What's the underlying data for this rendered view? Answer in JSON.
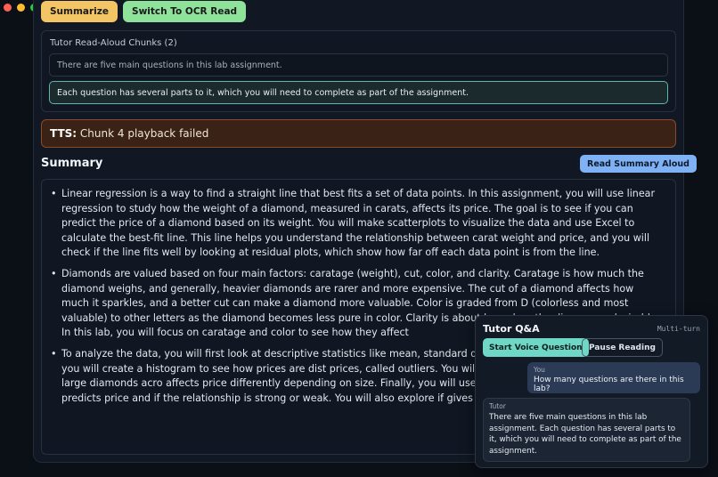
{
  "window": {
    "title": ""
  },
  "toolbar": {
    "summarize_label": "Summarize",
    "ocr_label": "Switch To OCR Read"
  },
  "chunks": {
    "title": "Tutor Read-Aloud Chunks (2)",
    "items": [
      "There are five main questions in this lab assignment.",
      "Each question has several parts to it, which you will need to complete as part of the assignment."
    ]
  },
  "tts": {
    "label": "TTS:",
    "message": "Chunk 4 playback failed"
  },
  "summary": {
    "heading": "Summary",
    "read_aloud_label": "Read Summary Aloud",
    "bullets": [
      "Linear regression is a way to find a straight line that best fits a set of data points. In this assignment, you will use linear regression to study how the weight of a diamond, measured in carats, affects its price. The goal is to see if you can predict the price of a diamond based on its weight. You will make scatterplots to visualize the data and use Excel to calculate the best-fit line. This line helps you understand the relationship between carat weight and price, and you will check if the line fits well by looking at residual plots, which show how far off each data point is from the line.",
      "Diamonds are valued based on four main factors: caratage (weight), cut, color, and clarity. Caratage is how much the diamond weighs, and generally, heavier diamonds are rarer and more expensive. The cut of a diamond affects how much it sparkles, and a better cut can make a diamond more valuable. Color is graded from D (colorless and most valuable) to other letters as the diamond becomes less pure in color. Clarity is about how clear the diam more desirable. In this lab, you will focus on caratage and color to see how they affect",
      "To analyze the data, you will first look at descriptive statistics like mean, standard devi spread of diamond prices. Then, you will create a histogram to see how prices are dist prices, called outliers. You will also compare prices for small and large diamonds acro affects price differently depending on size. Finally, you will use correlation and regress weight predicts price and if the relationship is strong or weak. You will also explore if gives a better fit for the data."
    ]
  },
  "qa": {
    "title": "Tutor Q&A",
    "mode": "Multi-turn",
    "start_label": "Start Voice Question",
    "pause_label": "Pause Reading",
    "messages": [
      {
        "role": "You",
        "text": "How many questions are there in this lab?"
      },
      {
        "role": "Tutor",
        "text": "There are five main questions in this lab assignment. Each question has several parts to it, which you will need to complete as part of the assignment."
      }
    ]
  },
  "colors": {
    "accent_yellow": "#f4c565",
    "accent_green": "#8ee29a",
    "accent_blue": "#7fb2f5",
    "accent_teal": "#6fd7c6",
    "error_bg": "#3a2216"
  }
}
